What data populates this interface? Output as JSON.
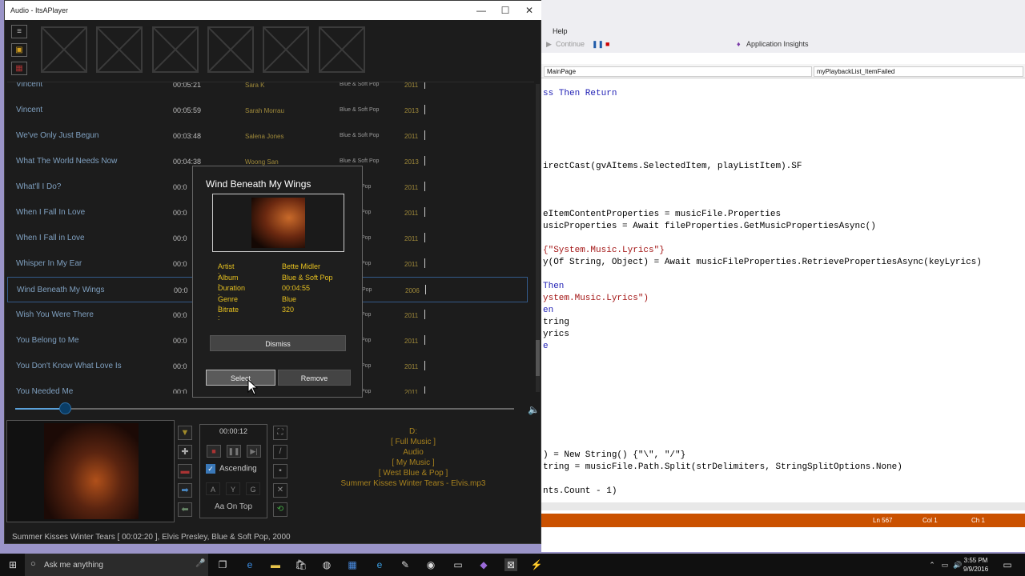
{
  "window": {
    "title": "Audio - ItsAPlayer",
    "minimize": "—",
    "maximize": "☐",
    "close": "✕"
  },
  "toolbar_icons": [
    "menu-icon",
    "folder-icon",
    "picture-icon"
  ],
  "playlist": {
    "rows": [
      {
        "title": "Vincent",
        "duration": "00:05:21",
        "artist": "Sara K",
        "album": "Blue & Soft Pop",
        "year": "2011"
      },
      {
        "title": "Vincent",
        "duration": "00:05:59",
        "artist": "Sarah Morrau",
        "album": "Blue & Soft Pop",
        "year": "2013"
      },
      {
        "title": "We've Only Just Begun",
        "duration": "00:03:48",
        "artist": "Salena Jones",
        "album": "Blue & Soft Pop",
        "year": "2011"
      },
      {
        "title": "What The World Needs Now",
        "duration": "00:04:38",
        "artist": "Woong San",
        "album": "Blue & Soft Pop",
        "year": "2013"
      },
      {
        "title": "What'll I Do?",
        "duration": "00:0",
        "artist": "",
        "album": "Pop",
        "year": "2011"
      },
      {
        "title": "When I Fall In Love",
        "duration": "00:0",
        "artist": "",
        "album": "Pop",
        "year": "2011"
      },
      {
        "title": "When I Fall in Love",
        "duration": "00:0",
        "artist": "",
        "album": "Pop",
        "year": "2011"
      },
      {
        "title": "Whisper In My Ear",
        "duration": "00:0",
        "artist": "",
        "album": "Pop",
        "year": "2011"
      },
      {
        "title": "Wind Beneath My Wings",
        "duration": "00:0",
        "artist": "",
        "album": "Pop",
        "year": "2006"
      },
      {
        "title": "Wish You Were There",
        "duration": "00:0",
        "artist": "",
        "album": "Pop",
        "year": "2011"
      },
      {
        "title": "You Belong to Me",
        "duration": "00:0",
        "artist": "",
        "album": "Pop",
        "year": "2011"
      },
      {
        "title": "You Don't Know What Love Is",
        "duration": "00:0",
        "artist": "",
        "album": "Pop",
        "year": "2011"
      },
      {
        "title": "You Needed Me",
        "duration": "00:0",
        "artist": "",
        "album": "Pop",
        "year": "2011"
      }
    ],
    "selected_index": 8
  },
  "seek": {
    "fraction": 0.1
  },
  "player": {
    "elapsed": "00:00:12",
    "ascending_label": "Ascending",
    "sort_letters": [
      "A",
      "Y",
      "G"
    ],
    "on_top_label": "Aa On Top"
  },
  "path_lines": [
    "D:",
    "[  Full  Music  ]",
    "Audio",
    "[  My  Music  ]",
    "[  West  Blue & Pop  ]",
    "Summer Kisses Winter Tears - Elvis.mp3"
  ],
  "status_line": "Summer Kisses Winter Tears  [ 00:02:20 ], Elvis Presley, Blue & Soft Pop, 2000",
  "dialog": {
    "title": "Wind Beneath My Wings",
    "fields": [
      {
        "label": "Artist :",
        "value": "Bette Midler"
      },
      {
        "label": "Album  :",
        "value": "Blue & Soft Pop"
      },
      {
        "label": "Duration :",
        "value": "00:04:55"
      },
      {
        "label": "Genre :",
        "value": "Blue"
      },
      {
        "label": "Bitrate :",
        "value": "320"
      }
    ],
    "dismiss": "Dismiss",
    "select": "Select",
    "remove": "Remove"
  },
  "vs": {
    "menu_help": "Help",
    "continue": "Continue",
    "insights": "Application Insights",
    "combo_left": "MainPage",
    "combo_right": "myPlaybackList_ItemFailed",
    "code": [
      "ss Then Return",
      "irectCast(gvAItems.SelectedItem, playListItem).SF",
      "eItemContentProperties = musicFile.Properties",
      "usicProperties = Await fileProperties.GetMusicPropertiesAsync()",
      "{\"System.Music.Lyrics\"}",
      "y(Of String, Object) = Await musicFileProperties.RetrievePropertiesAsync(keyLyrics)",
      "Then",
      "ystem.Music.Lyrics\")",
      "en",
      "tring",
      "yrics",
      "e",
      ") = New String() {\"\\\", \"/\"}",
      "tring = musicFile.Path.Split(strDelimiters, StringSplitOptions.None)",
      "nts.Count - 1)"
    ],
    "ln": "Ln 567",
    "col": "Col 1",
    "ch": "Ch 1"
  },
  "taskbar": {
    "search": "Ask me anything",
    "time": "3:55 PM",
    "date": "9/9/2016"
  }
}
